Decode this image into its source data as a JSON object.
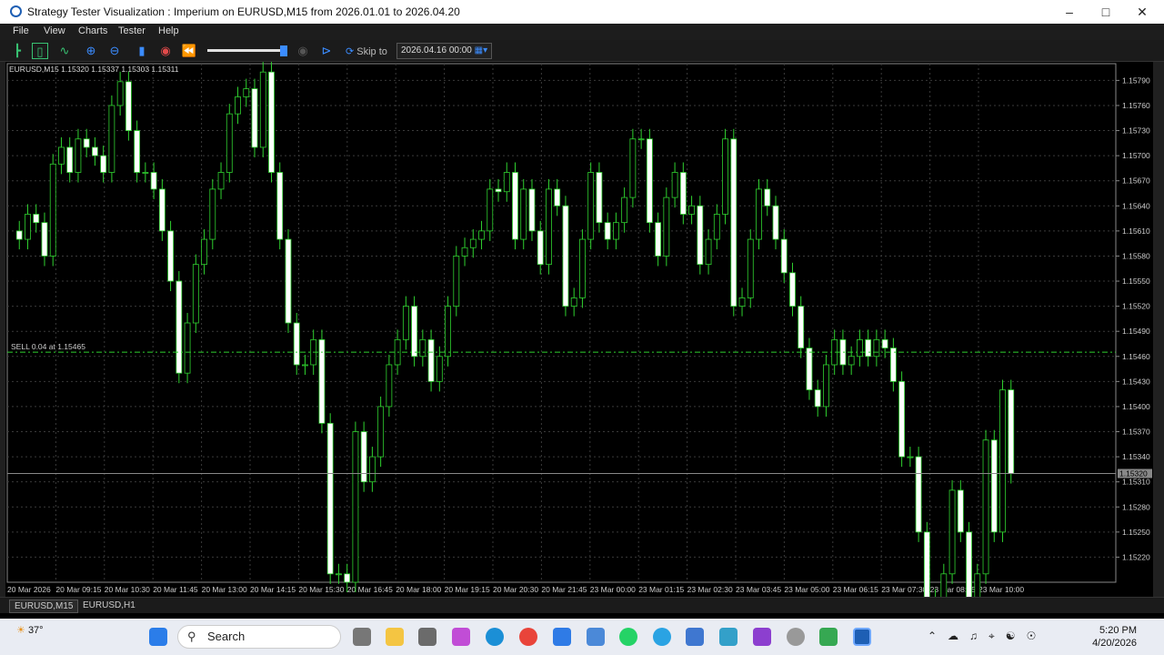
{
  "window": {
    "title": "Strategy Tester Visualization : Imperium on EURUSD,M15 from 2026.01.01 to 2026.04.20"
  },
  "menu": [
    "File",
    "View",
    "Charts",
    "Tester",
    "Help"
  ],
  "toolbar": {
    "skip_label": "Skip to",
    "skip_date": "2026.04.16 00:00"
  },
  "chart_data": {
    "type": "candlestick",
    "symbol_line": "EURUSD,M15  1.15320 1.15337 1.15303 1.15311",
    "trade_line_label": "SELL 0.04 at 1.15465",
    "trade_line_price": 1.15465,
    "current_price": 1.1532,
    "current_price_label": "1.15320",
    "ylim": [
      1.1519,
      1.1581
    ],
    "y_ticks": [
      "1.15790",
      "1.15760",
      "1.15730",
      "1.15700",
      "1.15670",
      "1.15640",
      "1.15610",
      "1.15580",
      "1.15550",
      "1.15520",
      "1.15490",
      "1.15460",
      "1.15430",
      "1.15400",
      "1.15370",
      "1.15340",
      "1.15310",
      "1.15280",
      "1.15250",
      "1.15220"
    ],
    "x_ticks": [
      "20 Mar 2026",
      "20 Mar 09:15",
      "20 Mar 10:30",
      "20 Mar 11:45",
      "20 Mar 13:00",
      "20 Mar 14:15",
      "20 Mar 15:30",
      "20 Mar 16:45",
      "20 Mar 18:00",
      "20 Mar 19:15",
      "20 Mar 20:30",
      "20 Mar 21:45",
      "23 Mar 00:00",
      "23 Mar 01:15",
      "23 Mar 02:30",
      "23 Mar 03:45",
      "23 Mar 05:00",
      "23 Mar 06:15",
      "23 Mar 07:30",
      "23 Mar 08:45",
      "23 Mar 10:00"
    ],
    "candle_color_up": "#000000",
    "candle_color_down": "#ffffff",
    "wick_color": "#2fd12f",
    "grid": true
  },
  "chart_tabs": [
    "EURUSD,M15",
    "EURUSD,H1"
  ],
  "taskbar": {
    "weather": "37°",
    "search_placeholder": "Search",
    "time": "5:20 PM",
    "date": "4/20/2026"
  }
}
